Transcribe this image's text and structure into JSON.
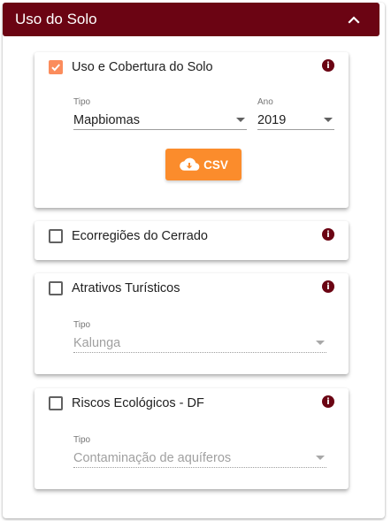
{
  "panel": {
    "title": "Uso do Solo"
  },
  "layers": [
    {
      "label": "Uso e Cobertura do Solo",
      "checked": true,
      "fields": [
        {
          "label": "Tipo",
          "value": "Mapbiomas"
        },
        {
          "label": "Ano",
          "value": "2019"
        }
      ],
      "button_label": "CSV"
    },
    {
      "label": "Ecorregiões do Cerrado",
      "checked": false
    },
    {
      "label": "Atrativos Turísticos",
      "checked": false,
      "fields": [
        {
          "label": "Tipo",
          "value": "Kalunga"
        }
      ]
    },
    {
      "label": "Riscos Ecológicos - DF",
      "checked": false,
      "fields": [
        {
          "label": "Tipo",
          "value": "Contaminação de aquíferos"
        }
      ]
    }
  ],
  "info_icon": "i",
  "colors": {
    "header": "#6b0413",
    "accent": "#fb8c2c",
    "checkbox_checked": "#fb8c5c"
  },
  "icons": {
    "collapse": "chevron-up-icon",
    "info": "info-icon",
    "download": "cloud-download-icon",
    "dropdown": "caret-down-icon"
  }
}
